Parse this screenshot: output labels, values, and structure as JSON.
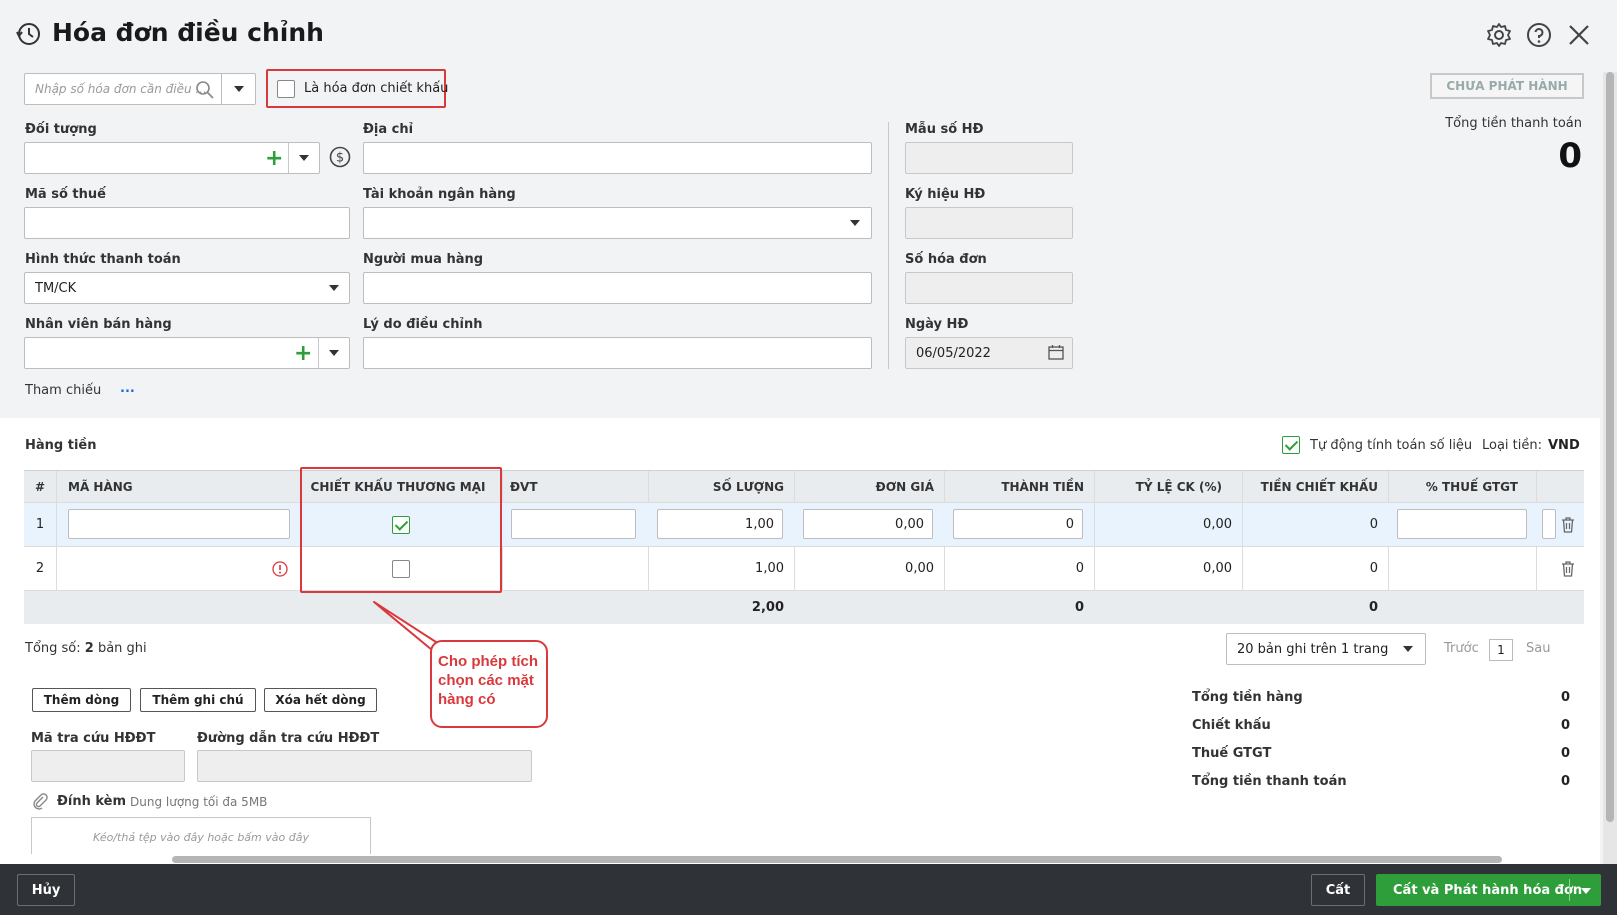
{
  "header": {
    "title": "Hóa đơn điều chỉnh"
  },
  "topbar": {
    "search_placeholder": "Nhập số hóa đơn cần điều ...",
    "discount_invoice_label": "Là hóa đơn chiết khấu",
    "status_badge": "CHƯA PHÁT HÀNH",
    "total_label": "Tổng tiền thanh toán",
    "total_value": "0"
  },
  "form": {
    "doi_tuong": "Đối tượng",
    "dia_chi": "Địa chỉ",
    "mau_so": "Mẫu số HĐ",
    "ma_so_thue": "Mã số thuế",
    "tai_khoan": "Tài khoản ngân hàng",
    "ky_hieu": "Ký hiệu HĐ",
    "hinh_thuc": "Hình thức thanh toán",
    "hinh_thuc_value": "TM/CK",
    "nguoi_mua": "Người mua hàng",
    "so_hoa_don": "Số hóa đơn",
    "nhan_vien": "Nhân viên bán hàng",
    "ly_do": "Lý do điều chỉnh",
    "ngay_hd": "Ngày HĐ",
    "ngay_hd_value": "06/05/2022",
    "tham_chieu": "Tham chiếu",
    "tham_chieu_more": "..."
  },
  "table": {
    "section_title": "Hàng tiền",
    "auto_calc_label": "Tự động tính toán số liệu",
    "currency_label": "Loại tiền:",
    "currency_value": "VND",
    "columns": [
      "#",
      "MÃ HÀNG",
      "CHIẾT KHẤU THƯƠNG MẠI",
      "ĐVT",
      "SỐ LƯỢNG",
      "ĐƠN GIÁ",
      "THÀNH TIỀN",
      "TỶ LỆ CK (%)",
      "TIỀN CHIẾT KHẤU",
      "% THUẾ GTGT"
    ],
    "rows": [
      {
        "no": "1",
        "so_luong": "1,00",
        "don_gia": "0,00",
        "thanh_tien": "0",
        "ty_le_ck": "0,00",
        "tien_ck": "0",
        "checked": true
      },
      {
        "no": "2",
        "so_luong": "1,00",
        "don_gia": "0,00",
        "thanh_tien": "0",
        "ty_le_ck": "0,00",
        "tien_ck": "0",
        "checked": false
      }
    ],
    "totals": {
      "so_luong": "2,00",
      "thanh_tien": "0",
      "tien_ck": "0"
    },
    "record_count_prefix": "Tổng số:",
    "record_count": "2",
    "record_count_suffix": "bản ghi",
    "page_size": "20 bản ghi trên 1 trang",
    "prev": "Trước",
    "page": "1",
    "next": "Sau"
  },
  "actions": {
    "add_row": "Thêm dòng",
    "add_note": "Thêm ghi chú",
    "delete_all": "Xóa hết dòng"
  },
  "lookup": {
    "code_label": "Mã tra cứu HĐĐT",
    "url_label": "Đường dẫn tra cứu HĐĐT"
  },
  "attach": {
    "label": "Đính kèm",
    "hint": "Dung lượng tối đa 5MB",
    "drop": "Kéo/thả tệp vào đây hoặc bấm vào đây"
  },
  "callout": {
    "text": "Cho phép tích chọn các mặt hàng có"
  },
  "summary": {
    "items": [
      {
        "label": "Tổng tiền hàng",
        "value": "0"
      },
      {
        "label": "Chiết khấu",
        "value": "0"
      },
      {
        "label": "Thuế GTGT",
        "value": "0"
      },
      {
        "label": "Tổng tiền thanh toán",
        "value": "0"
      }
    ]
  },
  "footer": {
    "cancel": "Hủy",
    "save": "Cất",
    "save_issue": "Cất và Phát hành hóa đơn"
  },
  "colors": {
    "accent_green": "#2e9e3a",
    "highlight_red": "#d9393c",
    "footer_bg": "#2f3236"
  }
}
